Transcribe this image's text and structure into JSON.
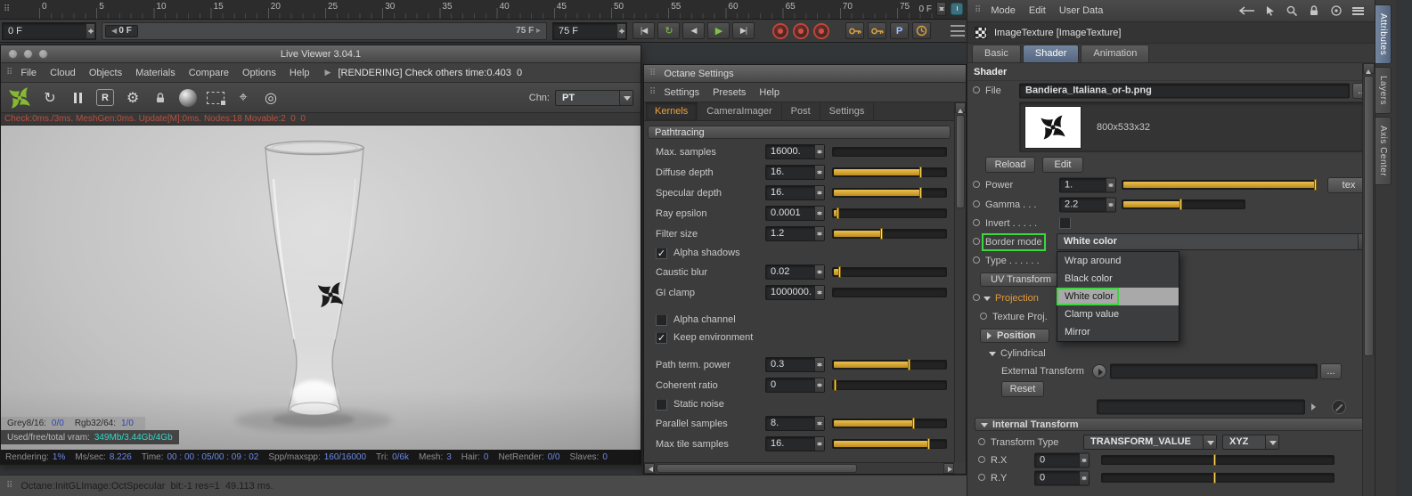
{
  "colors": {
    "octane_green": "#86b832",
    "slider_yellow": "#d9a62e",
    "annotation_green": "#3ed63e",
    "active_tab_blue": "#5d6f8c",
    "kernels_orange": "#ef9f3c",
    "stat_value_blue": "#6b88e0",
    "vram_teal": "#35d8c8",
    "check_text_red": "#b8503e"
  },
  "timeline": {
    "ticks": [
      "0",
      "5",
      "10",
      "15",
      "20",
      "25",
      "30",
      "35",
      "40",
      "45",
      "50",
      "55",
      "60",
      "65",
      "70",
      "75"
    ],
    "end_label": "0 F",
    "frame_field": "0 F",
    "marker": "0 F",
    "range_inline": "75 F",
    "range_field": "75 F"
  },
  "transport": {
    "buttons": [
      {
        "name": "go-to-start-button",
        "glyph": "|◀"
      },
      {
        "name": "play-loop-button",
        "glyph": "↻",
        "green": true
      },
      {
        "name": "previous-frame-button",
        "glyph": "◀"
      },
      {
        "name": "play-forward-button",
        "glyph": "▶",
        "green": true
      },
      {
        "name": "go-to-end-button",
        "glyph": "▶|"
      }
    ],
    "key_letter": "P"
  },
  "live_viewer": {
    "title": "Live Viewer 3.04.1",
    "menus": [
      "File",
      "Cloud",
      "Objects",
      "Materials",
      "Compare",
      "Options",
      "Help"
    ],
    "rendering_status": "[RENDERING] Check others time:0.403  0",
    "channel_label": "Chn:",
    "channel_value": "PT",
    "check_line": "Check:0ms./3ms. MeshGen:0ms. Update[M]:0ms. Nodes:18 Movable:2  0  0",
    "overlay1": [
      {
        "label": "Grey8/16:",
        "value": "0/0"
      },
      {
        "label": "Rgb32/64:",
        "value": "1/0"
      }
    ],
    "overlay2": {
      "label": "Used/free/total vram:",
      "value": "349Mb/3.44Gb/4Gb"
    },
    "stats": [
      {
        "label": "Rendering:",
        "value": "1%"
      },
      {
        "label": "Ms/sec:",
        "value": "8.226"
      },
      {
        "label": "Time:",
        "value": "00 : 00 : 05/00 : 09 : 02"
      },
      {
        "label": "Spp/maxspp:",
        "value": "160/16000"
      },
      {
        "label": "Tri:",
        "value": "0/6k"
      },
      {
        "label": "Mesh:",
        "value": "3"
      },
      {
        "label": "Hair:",
        "value": "0"
      },
      {
        "label": "NetRender:",
        "value": "0/0"
      },
      {
        "label": "Slaves:",
        "value": "0"
      }
    ]
  },
  "octane_settings": {
    "title": "Octane Settings",
    "menus": [
      "Settings",
      "Presets",
      "Help"
    ],
    "tabs": [
      "Kernels",
      "CameraImager",
      "Post",
      "Settings"
    ],
    "active_tab": "Kernels",
    "section": "Pathtracing",
    "params": [
      {
        "kind": "spin",
        "label": "Max. samples",
        "value": "16000.",
        "fill": 0
      },
      {
        "kind": "spin",
        "label": "Diffuse depth",
        "value": "16.",
        "fill": 0.78
      },
      {
        "kind": "spin",
        "label": "Specular depth",
        "value": "16.",
        "fill": 0.78
      },
      {
        "kind": "spin",
        "label": "Ray epsilon",
        "value": "0.0001",
        "fill": 0.05
      },
      {
        "kind": "spin",
        "label": "Filter size",
        "value": "1.2",
        "fill": 0.43
      },
      {
        "kind": "check",
        "label": "Alpha shadows",
        "checked": true
      },
      {
        "kind": "spin",
        "label": "Caustic blur",
        "value": "0.02",
        "fill": 0.06
      },
      {
        "kind": "spin",
        "label": "GI clamp",
        "value": "1000000.",
        "fill": 0,
        "gap_after": true
      },
      {
        "kind": "check",
        "label": "Alpha channel",
        "checked": false
      },
      {
        "kind": "check",
        "label": "Keep environment",
        "checked": true,
        "gap_after": true
      },
      {
        "kind": "spin",
        "label": "Path term. power",
        "value": "0.3",
        "fill": 0.68
      },
      {
        "kind": "spin",
        "label": "Coherent ratio",
        "value": "0",
        "fill": 0.02
      },
      {
        "kind": "check",
        "label": "Static noise",
        "checked": false
      },
      {
        "kind": "spin",
        "label": "Parallel samples",
        "value": "8.",
        "fill": 0.72
      },
      {
        "kind": "spin",
        "label": "Max tile samples",
        "value": "16.",
        "fill": 0.85
      }
    ]
  },
  "attributes": {
    "menus": [
      "Mode",
      "Edit",
      "User Data"
    ],
    "title": "ImageTexture [ImageTexture]",
    "tabs": [
      "Basic",
      "Shader",
      "Animation"
    ],
    "active_tab": "Shader",
    "section_title": "Shader",
    "file": {
      "label": "File",
      "value": "Bandiera_Italiana_or-b.png"
    },
    "thumb_info": "800x533x32",
    "buttons": {
      "reload": "Reload",
      "edit": "Edit",
      "tex": "tex",
      "reset": "Reset",
      "browse": "..."
    },
    "power": {
      "label": "Power",
      "value": "1.",
      "fill": 1
    },
    "gamma": {
      "label": "Gamma . . .",
      "value": "2.2",
      "fill": 0.48
    },
    "invert": {
      "label": "Invert . . . . .",
      "checked": false
    },
    "border_mode": {
      "label": "Border mode",
      "value": "White color",
      "options": [
        "Wrap around",
        "Black color",
        "White color",
        "Clamp value",
        "Mirror"
      ],
      "selected_index": 2
    },
    "background_rows": {
      "type_label": "Type . . . . . .",
      "uv_transform": "UV Transform",
      "projection": "Projection",
      "texture_proj": "Texture Proj.",
      "position": "Position"
    },
    "cylindrical": "Cylindrical",
    "external_transform": "External Transform",
    "internal_transform": "Internal Transform",
    "transform_type": {
      "label": "Transform Type",
      "value": "TRANSFORM_VALUE",
      "axis": "XYZ"
    },
    "rx": {
      "label": "R.X",
      "value": "0",
      "knob": 0.49
    },
    "ry": {
      "label": "R.Y",
      "value": "0",
      "knob": 0.49
    }
  },
  "side_tabs": [
    "Attributes",
    "Layers",
    "Axis Center"
  ],
  "status_bar": {
    "text": "Octane:InitGLImage:OctSpecular  bit:-1 res=1  49.113 ms."
  }
}
